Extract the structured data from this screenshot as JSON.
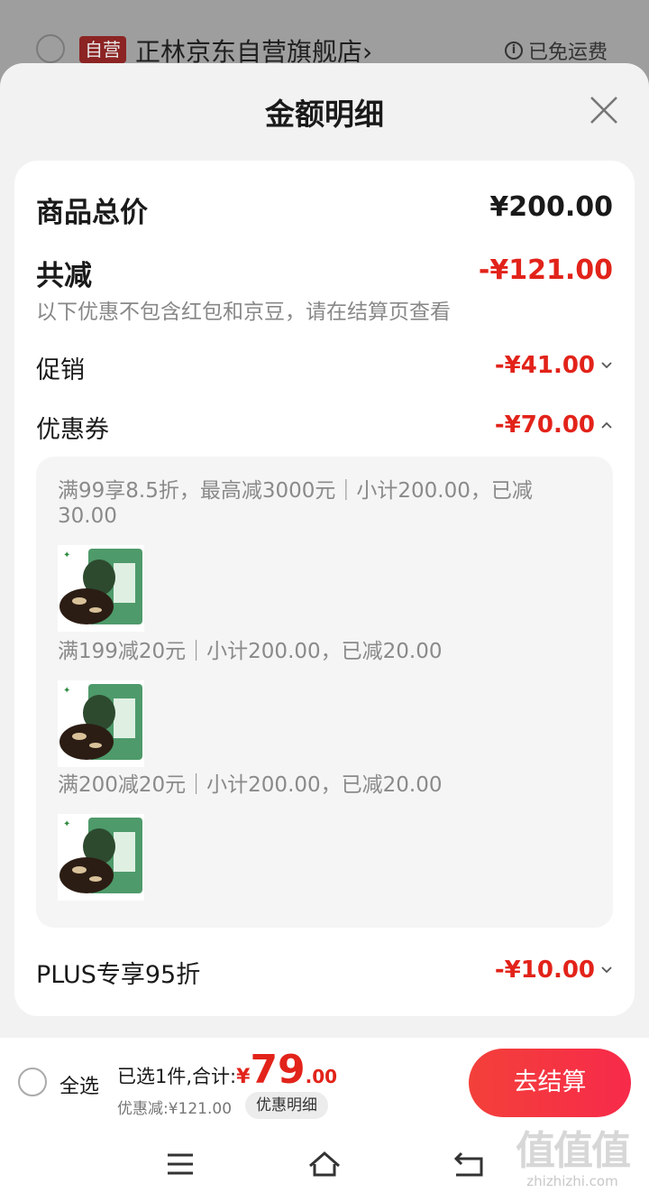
{
  "background": {
    "store_badge": "自营",
    "store_name": "正林京东自营旗舰店",
    "store_chevron": "›",
    "shipping_icon": "i",
    "shipping_text": "已免运费"
  },
  "sheet": {
    "title": "金额明细",
    "close_icon": "close-icon"
  },
  "card": {
    "total_label": "商品总价",
    "total_value": "¥200.00",
    "discount_label": "共减",
    "discount_value": "-¥121.00",
    "discount_note": "以下优惠不包含红包和京豆，请在结算页查看",
    "promo_label": "促销",
    "promo_value": "-¥41.00",
    "coupon_label": "优惠券",
    "coupon_value": "-¥70.00",
    "coupons": [
      {
        "text": "满99享8.5折，最高减3000元｜小计200.00，已减30.00"
      },
      {
        "text": "满199减20元｜小计200.00，已减20.00"
      },
      {
        "text": "满200减20元｜小计200.00，已减20.00"
      }
    ],
    "plus_label": "PLUS专享95折",
    "plus_value": "-¥10.00"
  },
  "bottom_bar": {
    "select_all": "全选",
    "selected_label": "已选1件,合计:",
    "currency": "¥",
    "total_int": "79",
    "total_dec": ".00",
    "discount_line": "优惠减:¥121.00",
    "detail_button": "优惠明细",
    "checkout_button": "去结算"
  },
  "watermark": {
    "logo": "值值值",
    "url": "zhizhizhi.com"
  },
  "colors": {
    "accent": "#e2231a",
    "checkout": "#f3403a"
  }
}
